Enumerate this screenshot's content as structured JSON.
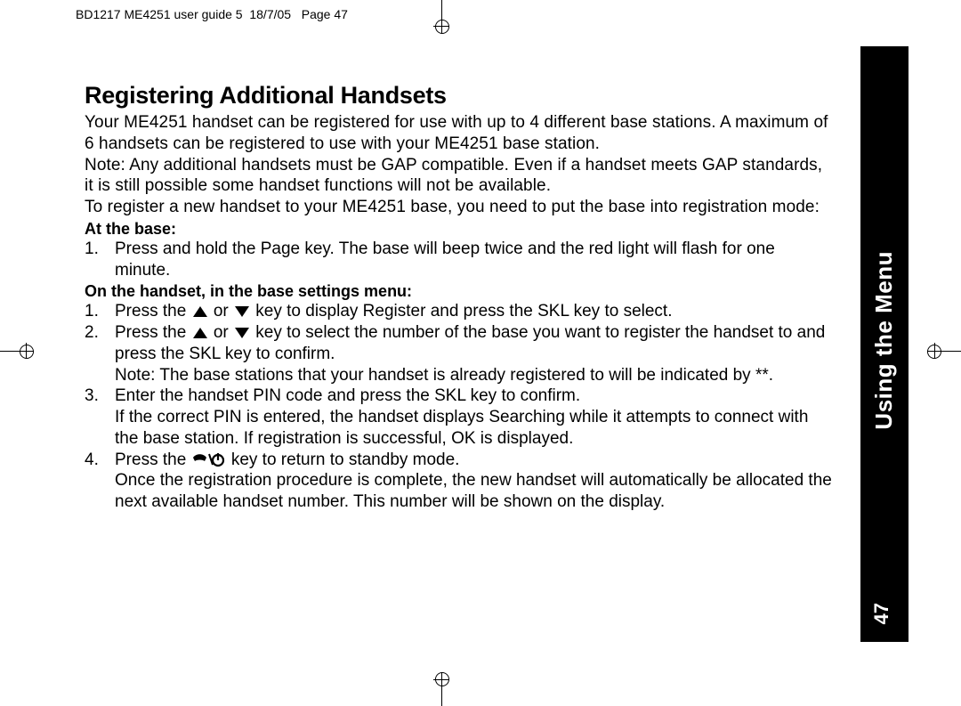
{
  "header": {
    "doc_id": "BD1217 ME4251 user guide 5",
    "date": "18/7/05",
    "page_label": "Page 47"
  },
  "side_tab": {
    "section": "Using the Menu",
    "page_number": "47"
  },
  "content": {
    "title": "Registering Additional Handsets",
    "intro1": "Your ME4251 handset can be registered for use with up to 4 different base stations. A maximum of 6 handsets can be registered to use with your ME4251 base station.",
    "intro2": "Note: Any additional handsets must be GAP compatible. Even if a handset meets GAP standards, it is still possible some handset functions will not be available.",
    "intro3": "To register a new handset to your ME4251 base, you need to put the base into registration mode:",
    "sub1": "At the base:",
    "base_steps": {
      "s1": "Press and hold the Page key. The base will beep twice and the red light will flash for one minute."
    },
    "sub2": "On the handset, in the base settings menu:",
    "hs": {
      "s1a": "Press the ",
      "s1b": " or ",
      "s1c": " key to display Register  and press the SKL key to select.",
      "s2a": "Press the ",
      "s2b": " or ",
      "s2c": " key to select the number of the base you want to register the handset to and press the SKL key to confirm.",
      "s2note": "Note: The base stations that your handset is already registered to will be indicated by **.",
      "s3a": "Enter the handset PIN code and press the SKL key to confirm.",
      "s3b": "If the correct PIN is entered, the handset displays Searching while it attempts to connect with the base station. If registration is successful,  OK is displayed.",
      "s4a": "Press the ",
      "s4b": " key to return to standby mode.",
      "s4c": "Once the registration procedure is complete, the new handset will automatically be allocated the next available handset number. This number will be shown on the display."
    }
  }
}
